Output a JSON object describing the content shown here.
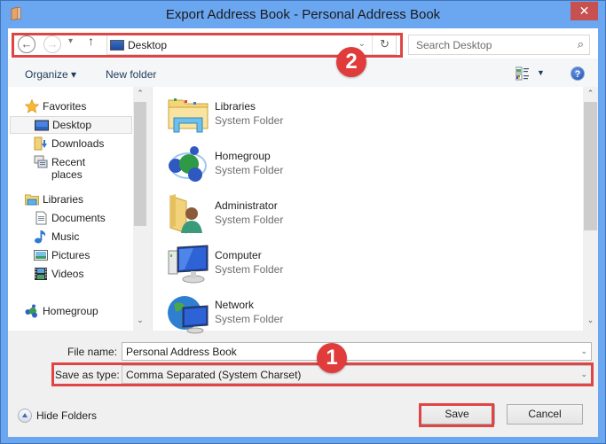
{
  "window": {
    "title": "Export Address Book - Personal Address Book",
    "close_glyph": "✕"
  },
  "navbar": {
    "back_glyph": "←",
    "forward_glyph": "→",
    "recent_glyph": "▾",
    "up_glyph": "↑",
    "address": "Desktop",
    "address_dropdown_glyph": "⌄",
    "refresh_glyph": "↻",
    "search_placeholder": "Search Desktop",
    "search_glyph": "⌕"
  },
  "toolbar": {
    "organize_label": "Organize ▾",
    "new_folder_label": "New folder",
    "views_dropdown_glyph": "▼",
    "help_glyph": "?"
  },
  "sidebar": {
    "items": [
      {
        "label": "Favorites",
        "icon": "star-icon",
        "level": 0
      },
      {
        "label": "Desktop",
        "icon": "desktop-icon",
        "level": 1,
        "selected": true
      },
      {
        "label": "Downloads",
        "icon": "downloads-icon",
        "level": 1
      },
      {
        "label": "Recent places",
        "icon": "recent-places-icon",
        "level": 1
      },
      {
        "label": "Libraries",
        "icon": "libraries-icon",
        "level": 0
      },
      {
        "label": "Documents",
        "icon": "documents-icon",
        "level": 1
      },
      {
        "label": "Music",
        "icon": "music-icon",
        "level": 1
      },
      {
        "label": "Pictures",
        "icon": "pictures-icon",
        "level": 1
      },
      {
        "label": "Videos",
        "icon": "videos-icon",
        "level": 1
      },
      {
        "label": "Homegroup",
        "icon": "homegroup-icon",
        "level": 0
      }
    ],
    "scroll_up_glyph": "⌃",
    "scroll_down_glyph": "⌄"
  },
  "content": {
    "items": [
      {
        "name": "Libraries",
        "type": "System Folder",
        "icon": "libraries-folder-icon"
      },
      {
        "name": "Homegroup",
        "type": "System Folder",
        "icon": "homegroup-icon"
      },
      {
        "name": "Administrator",
        "type": "System Folder",
        "icon": "user-folder-icon"
      },
      {
        "name": "Computer",
        "type": "System Folder",
        "icon": "computer-icon"
      },
      {
        "name": "Network",
        "type": "System Folder",
        "icon": "network-icon"
      }
    ],
    "scroll_up_glyph": "⌃",
    "scroll_down_glyph": "⌄"
  },
  "form": {
    "file_name_label": "File name:",
    "file_name_value": "Personal Address Book",
    "save_type_label": "Save as type:",
    "save_type_value": "Comma Separated (System Charset)",
    "dropdown_glyph": "⌄"
  },
  "footer": {
    "hide_folders_label": "Hide Folders",
    "save_label": "Save",
    "cancel_label": "Cancel"
  },
  "annotations": {
    "badge_1": "1",
    "badge_2": "2",
    "highlight_color": "#e04545"
  }
}
